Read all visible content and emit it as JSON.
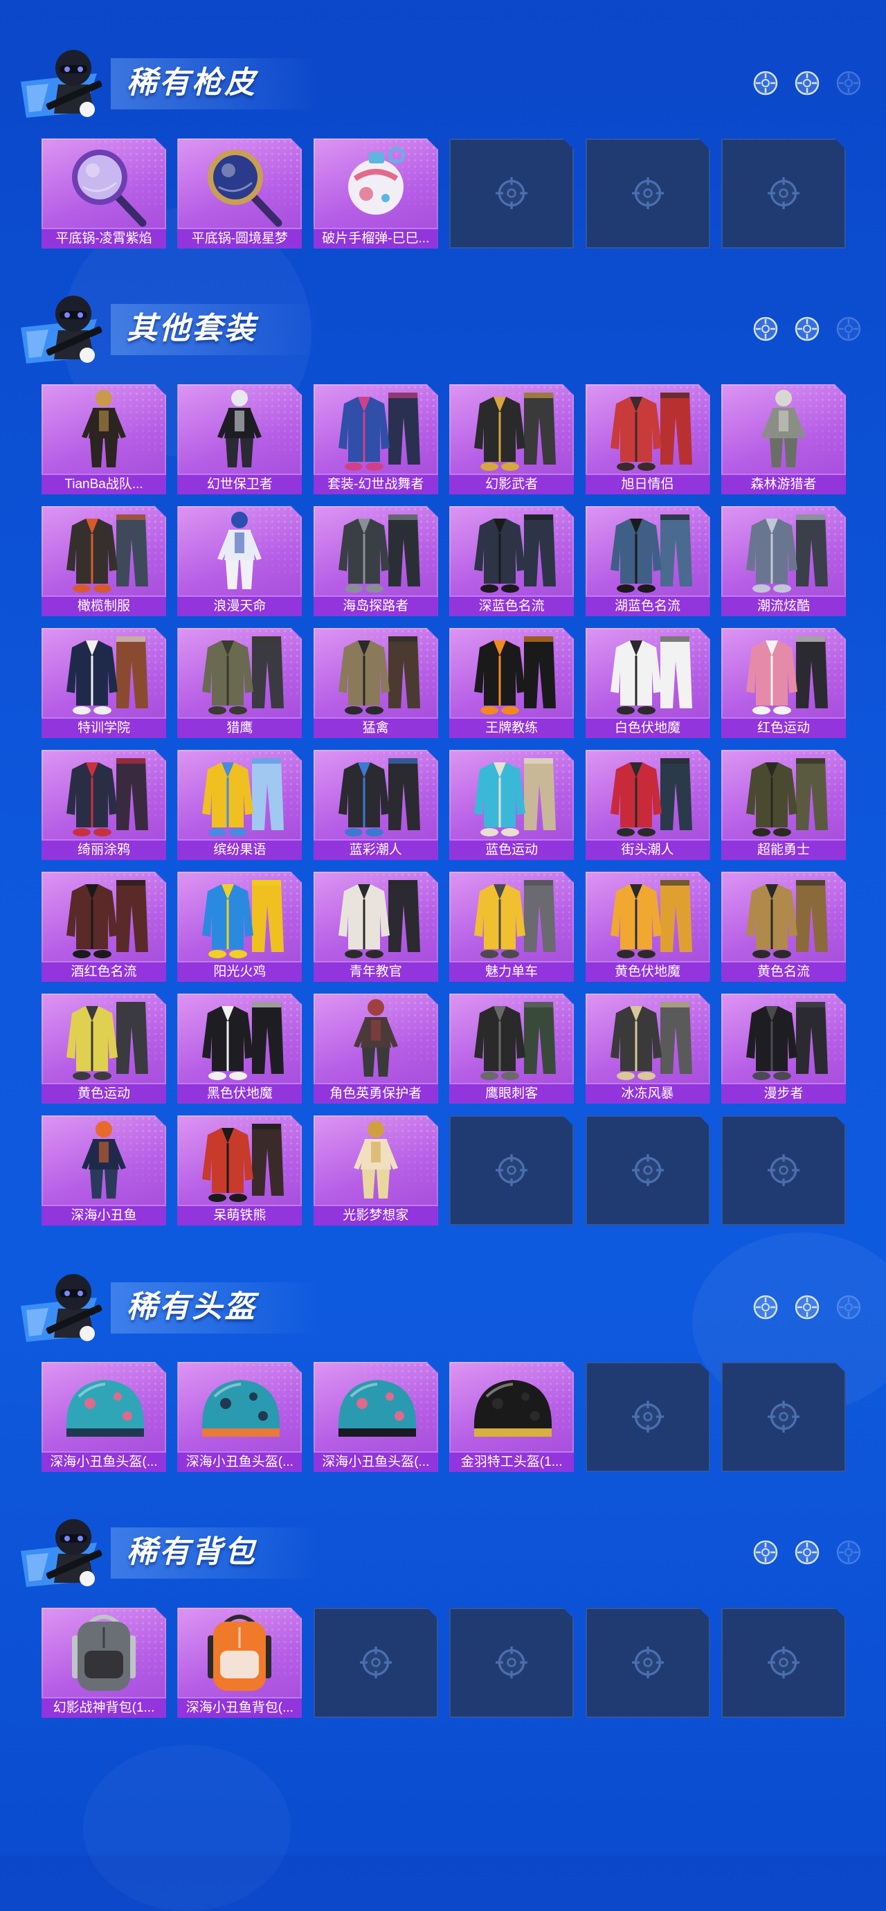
{
  "theme": {
    "background": [
      "#0b47c9",
      "#0d57dc",
      "#0b4cd0"
    ],
    "card_gradient": [
      "#dc95f2",
      "#b65ee6",
      "#a24ad9"
    ],
    "label_bg": "#9235dd",
    "empty_slot_bg": "#1f3b72",
    "empty_slot_icon": "#4a6fb0"
  },
  "header_icons": [
    "soldier-emblem-icon",
    "crosshair-icon"
  ],
  "sections": [
    {
      "title": "稀有枪皮",
      "items": [
        {
          "label": "平底锅-凌霄紫焰",
          "icon": "pan-icon",
          "colors": [
            "#c9b8f0",
            "#6d3fb3",
            "#3a2a6a"
          ]
        },
        {
          "label": "平底锅-圆境星梦",
          "icon": "pan-icon",
          "colors": [
            "#2a3a8c",
            "#c8a050",
            "#3a2a6a"
          ]
        },
        {
          "label": "破片手榴弹-巳巳...",
          "icon": "grenade-icon",
          "colors": [
            "#f1eef6",
            "#e46a8a",
            "#59b7e0"
          ]
        }
      ],
      "empty_slots": 3
    },
    {
      "title": "其他套装",
      "items": [
        {
          "label": "TianBa战队...",
          "icon": "figure-icon",
          "colors": [
            "#2b2420",
            "#c89a4a",
            "#2b2420"
          ]
        },
        {
          "label": "幻世保卫者",
          "icon": "figure-icon",
          "colors": [
            "#1d1d24",
            "#e8e8ee",
            "#2a2a34"
          ]
        },
        {
          "label": "套装-幻世战舞者",
          "icon": "outfit-icon",
          "colors": [
            "#2f4fa8",
            "#d0408a",
            "#2a3050"
          ]
        },
        {
          "label": "幻影武者",
          "icon": "outfit-icon",
          "colors": [
            "#2a2a2a",
            "#d8a640",
            "#3a3a3a"
          ]
        },
        {
          "label": "旭日情侣",
          "icon": "outfit-icon",
          "colors": [
            "#c93a3a",
            "#3a2a2a",
            "#b83030"
          ]
        },
        {
          "label": "森林游猎者",
          "icon": "figure-icon",
          "colors": [
            "#8a8f86",
            "#d8d8d0",
            "#6a6f66"
          ]
        },
        {
          "label": "橄榄制服",
          "icon": "outfit-icon",
          "colors": [
            "#35302e",
            "#d85a2a",
            "#3e4a5a"
          ]
        },
        {
          "label": "浪漫天命",
          "icon": "figure-icon",
          "colors": [
            "#e8ecf6",
            "#2a4fb0",
            "#f0f0f6"
          ]
        },
        {
          "label": "海岛探路者",
          "icon": "outfit-icon",
          "colors": [
            "#3a3f46",
            "#8a8f96",
            "#2a2f36"
          ]
        },
        {
          "label": "深蓝色名流",
          "icon": "outfit-icon",
          "colors": [
            "#2c3446",
            "#1a1a1a",
            "#2c3446"
          ]
        },
        {
          "label": "湖蓝色名流",
          "icon": "outfit-icon",
          "colors": [
            "#3f5f86",
            "#1a1a1a",
            "#4a6a90"
          ]
        },
        {
          "label": "潮流炫酷",
          "icon": "outfit-icon",
          "colors": [
            "#6a7590",
            "#c0c8d8",
            "#3a3f4a"
          ]
        },
        {
          "label": "特训学院",
          "icon": "outfit-icon",
          "colors": [
            "#1f2a4a",
            "#f0f0f0",
            "#8a4a30"
          ]
        },
        {
          "label": "猎鹰",
          "icon": "outfit-icon",
          "colors": [
            "#6a6a50",
            "#3a3a30",
            "#3a3a40"
          ]
        },
        {
          "label": "猛禽",
          "icon": "outfit-icon",
          "colors": [
            "#8a7a5a",
            "#2a2a2a",
            "#4a3a30"
          ]
        },
        {
          "label": "王牌教练",
          "icon": "outfit-icon",
          "colors": [
            "#1a1a1a",
            "#f08a20",
            "#1a1a1a"
          ]
        },
        {
          "label": "白色伏地魔",
          "icon": "outfit-icon",
          "colors": [
            "#f2f2f2",
            "#2a2a2a",
            "#f2f2f2"
          ]
        },
        {
          "label": "红色运动",
          "icon": "outfit-icon",
          "colors": [
            "#e58aa8",
            "#f4f4f4",
            "#2a2a30"
          ]
        },
        {
          "label": "绮丽涂鸦",
          "icon": "outfit-icon",
          "colors": [
            "#2a2e44",
            "#c83040",
            "#3a2a40"
          ]
        },
        {
          "label": "缤纷果语",
          "icon": "outfit-icon",
          "colors": [
            "#f0c020",
            "#4a8ae0",
            "#a0c8f0"
          ]
        },
        {
          "label": "蓝彩潮人",
          "icon": "outfit-icon",
          "colors": [
            "#2a2a30",
            "#3a7ad0",
            "#2a2a30"
          ]
        },
        {
          "label": "蓝色运动",
          "icon": "outfit-icon",
          "colors": [
            "#3ab8d8",
            "#e8e0d0",
            "#c8b898"
          ]
        },
        {
          "label": "街头潮人",
          "icon": "outfit-icon",
          "colors": [
            "#c82a3a",
            "#2a2a2a",
            "#2a3a4a"
          ]
        },
        {
          "label": "超能勇士",
          "icon": "outfit-icon",
          "colors": [
            "#4a4a30",
            "#2a2a20",
            "#5a5a40"
          ]
        },
        {
          "label": "酒红色名流",
          "icon": "outfit-icon",
          "colors": [
            "#5a2a28",
            "#1a1a1a",
            "#5a2a28"
          ]
        },
        {
          "label": "阳光火鸡",
          "icon": "outfit-icon",
          "colors": [
            "#2a8ae0",
            "#f0d020",
            "#f0c020"
          ]
        },
        {
          "label": "青年教官",
          "icon": "outfit-icon",
          "colors": [
            "#e8e4dc",
            "#2a2a2a",
            "#2a2a30"
          ]
        },
        {
          "label": "魅力单车",
          "icon": "outfit-icon",
          "colors": [
            "#f0c030",
            "#4a4a50",
            "#6a6a70"
          ]
        },
        {
          "label": "黄色伏地魔",
          "icon": "outfit-icon",
          "colors": [
            "#f0a830",
            "#2a2a2a",
            "#e0a030"
          ]
        },
        {
          "label": "黄色名流",
          "icon": "outfit-icon",
          "colors": [
            "#b08a4a",
            "#2a2a2a",
            "#8a6a3a"
          ]
        },
        {
          "label": "黄色运动",
          "icon": "outfit-icon",
          "colors": [
            "#e0d050",
            "#3a3a40",
            "#3a3a40"
          ]
        },
        {
          "label": "黑色伏地魔",
          "icon": "outfit-icon",
          "colors": [
            "#1e1e22",
            "#f0f0f0",
            "#1e1e22"
          ]
        },
        {
          "label": "角色英勇保护者",
          "icon": "figure-icon",
          "colors": [
            "#4a3a3a",
            "#a04040",
            "#3a3a3a"
          ]
        },
        {
          "label": "鹰眼刺客",
          "icon": "outfit-icon",
          "colors": [
            "#2a2a2a",
            "#6a6a6a",
            "#3a4a3a"
          ]
        },
        {
          "label": "冰冻风暴",
          "icon": "outfit-icon",
          "colors": [
            "#3a3a3a",
            "#d8c89a",
            "#5a5a5a"
          ]
        },
        {
          "label": "漫步者",
          "icon": "outfit-icon",
          "colors": [
            "#1e1e22",
            "#4a4a50",
            "#2a2a30"
          ]
        },
        {
          "label": "深海小丑鱼",
          "icon": "figure-icon",
          "colors": [
            "#1f2a4a",
            "#e86a2a",
            "#2a3a5a"
          ]
        },
        {
          "label": "呆萌铁熊",
          "icon": "outfit-icon",
          "colors": [
            "#c83a2a",
            "#1a1a1a",
            "#3a2a2a"
          ]
        },
        {
          "label": "光影梦想家",
          "icon": "figure-icon",
          "colors": [
            "#f0e0c0",
            "#d0a040",
            "#e8d8a0"
          ]
        }
      ],
      "empty_slots": 3
    },
    {
      "title": "稀有头盔",
      "items": [
        {
          "label": "深海小丑鱼头盔(...",
          "icon": "helmet-icon",
          "colors": [
            "#2ea6b8",
            "#1f3a50",
            "#e06a8a"
          ]
        },
        {
          "label": "深海小丑鱼头盔(...",
          "icon": "helmet-icon",
          "colors": [
            "#2a9ab0",
            "#e87a3a",
            "#1f3a50"
          ]
        },
        {
          "label": "深海小丑鱼头盔(...",
          "icon": "helmet-icon",
          "colors": [
            "#2a9ab0",
            "#1a1a22",
            "#e06a8a"
          ]
        },
        {
          "label": "金羽特工头盔(1...",
          "icon": "helmet-icon",
          "colors": [
            "#1a1a1a",
            "#d8b040",
            "#2a2a2a"
          ]
        }
      ],
      "empty_slots": 2
    },
    {
      "title": "稀有背包",
      "items": [
        {
          "label": "幻影战神背包(1...",
          "icon": "backpack-icon",
          "colors": [
            "#6a6f76",
            "#2a2a2e",
            "#c0c4c8"
          ]
        },
        {
          "label": "深海小丑鱼背包(...",
          "icon": "backpack-icon",
          "colors": [
            "#f07a2a",
            "#f4f4f4",
            "#2a2a2a"
          ]
        }
      ],
      "empty_slots": 4
    }
  ]
}
